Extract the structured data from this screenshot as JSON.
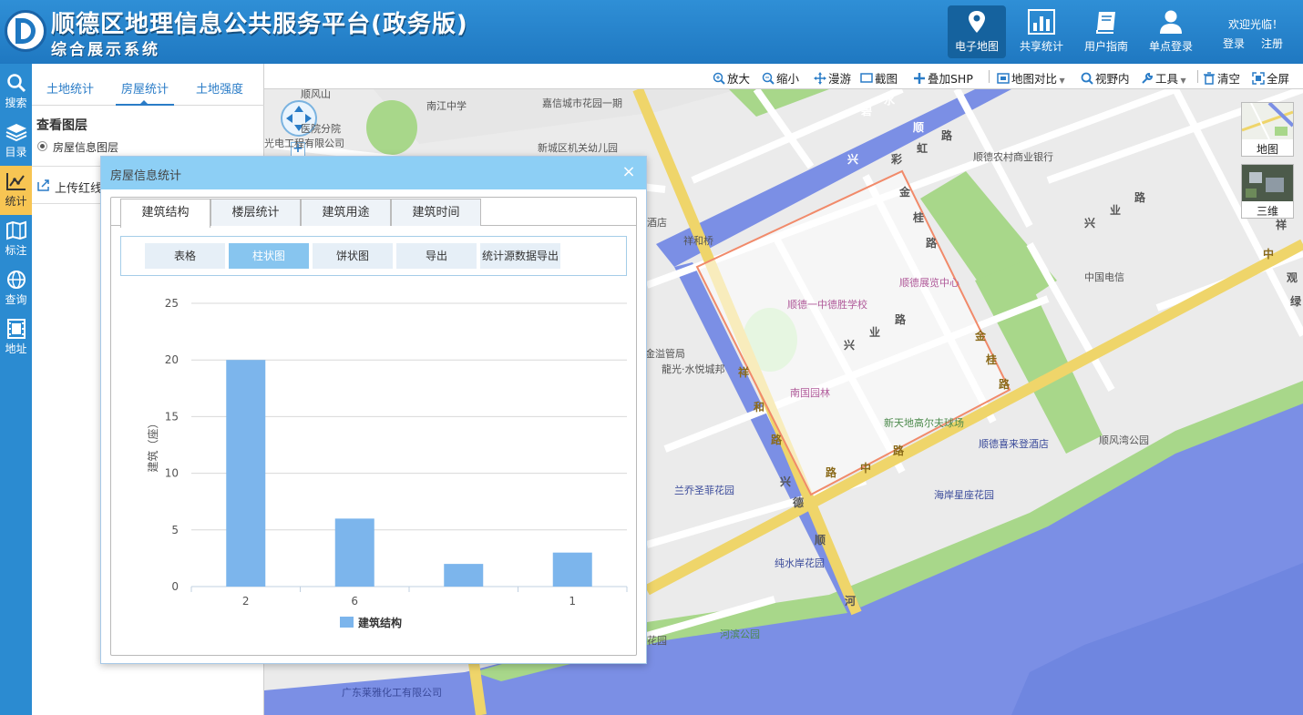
{
  "header": {
    "title": "顺德区地理信息公共服务平台(政务版)",
    "subtitle": "综合展示系统",
    "nav": [
      {
        "label": "电子地图",
        "icon": "map-pin-icon",
        "active": true
      },
      {
        "label": "共享统计",
        "icon": "bar-chart-icon",
        "active": false
      },
      {
        "label": "用户指南",
        "icon": "book-icon",
        "active": false
      },
      {
        "label": "单点登录",
        "icon": "user-icon",
        "active": false
      }
    ],
    "welcome": "欢迎光临！",
    "login": "登录",
    "register": "注册"
  },
  "rail": [
    {
      "label": "搜索",
      "icon": "search-icon"
    },
    {
      "label": "目录",
      "icon": "layers-icon"
    },
    {
      "label": "统计",
      "icon": "chart-icon",
      "active": true
    },
    {
      "label": "标注",
      "icon": "map-mark-icon"
    },
    {
      "label": "查询",
      "icon": "globe-icon"
    },
    {
      "label": "地址",
      "icon": "film-icon"
    }
  ],
  "panel": {
    "tabs": [
      "土地统计",
      "房屋统计",
      "土地强度"
    ],
    "active_tab": "房屋统计",
    "layer_title": "查看图层",
    "layer_option": "房屋信息图层",
    "upload_label": "上传红线"
  },
  "toolbar": [
    {
      "label": "放大",
      "icon": "zoom-in-icon"
    },
    {
      "label": "缩小",
      "icon": "zoom-out-icon"
    },
    {
      "label": "漫游",
      "icon": "pan-icon"
    },
    {
      "label": "截图",
      "icon": "screenshot-icon"
    },
    {
      "label": "叠加SHP",
      "icon": "plus-icon"
    },
    {
      "label": "地图对比",
      "icon": "compare-icon"
    },
    {
      "label": "视野内",
      "icon": "search-icon"
    },
    {
      "label": "工具",
      "icon": "wrench-icon"
    },
    {
      "label": "清空",
      "icon": "trash-icon"
    },
    {
      "label": "全屏",
      "icon": "fullscreen-icon"
    }
  ],
  "basemaps": [
    {
      "label": "地图"
    },
    {
      "label": "三维"
    }
  ],
  "map": {
    "pois": {
      "shunfengshan": "顺风山",
      "nanjiang": "南江中学",
      "jiaxin": "嘉信城市花园一期",
      "hospital": "医院分院",
      "guangdian": "光电工程有限公司",
      "xincheng": "新城区机关幼儿园",
      "bank": "顺德农村商业银行",
      "jiudian": "酒店",
      "xiangheqiao": "祥和桥",
      "zhanlan": "顺德展览中心",
      "zhongde": "顺德一中德胜学校",
      "telecom": "中国电信",
      "jinyuan": "金溢管局",
      "longguang": "龍光·水悦城邦",
      "nanguo": "南国园林",
      "golf": "新天地高尔夫球场",
      "xilaideng": "顺德喜来登酒店",
      "shunfengwan": "顺风湾公园",
      "lanqiao": "兰乔圣菲花园",
      "haian": "海岸星座花园",
      "chunshui": "纯水岸花园",
      "huayuan": "花园",
      "hebin": "河滨公园",
      "laiya": "广东莱雅化工有限公司"
    },
    "roads": {
      "bishui": [
        "碧",
        "水",
        "顺"
      ],
      "xinghong": [
        "彩",
        "虹",
        "路"
      ],
      "jingui": [
        "金",
        "桂",
        "路"
      ],
      "xingye": [
        "兴",
        "业",
        "路"
      ],
      "xingye2": [
        "兴",
        "业",
        "路"
      ],
      "xiangheL": [
        "祥",
        "和",
        "路"
      ],
      "zhonglu": [
        "中",
        "路"
      ],
      "lu": "路",
      "jingui2": [
        "金",
        "桂",
        "路"
      ],
      "xiangshun": [
        "兴",
        "德",
        "顺"
      ],
      "he": "河",
      "xing": "兴",
      "zhong": "中",
      "guan": [
        "观",
        "绿"
      ],
      "xiang": "祥"
    }
  },
  "dialog": {
    "title": "房屋信息统计",
    "close": "×",
    "tabs": [
      "建筑结构",
      "楼层统计",
      "建筑用途",
      "建筑时间"
    ],
    "active_tab": "建筑结构",
    "sub_buttons": [
      "表格",
      "柱状图",
      "饼状图",
      "导出",
      "统计源数据导出"
    ],
    "active_sub": "柱状图"
  },
  "chart_data": {
    "type": "bar",
    "categories": [
      "2",
      "6",
      "",
      "1"
    ],
    "series": [
      {
        "name": "建筑结构",
        "values": [
          20,
          6,
          2,
          3
        ],
        "color": "#7cb5ec"
      }
    ],
    "ylabel": "建筑（座）",
    "ylim": [
      0,
      25
    ],
    "yticks": [
      0,
      5,
      10,
      15,
      20,
      25
    ],
    "grid": true,
    "legend": "bottom"
  },
  "colors": {
    "header": "#2f8fd6",
    "rail": "#2b8bd1",
    "rail_active": "#f7c553",
    "accent": "#2a7cc7",
    "bar": "#7cb5ec",
    "dialog_head": "#8dcff5",
    "river": "#7b8fe5",
    "green": "#a8d78a",
    "main_road": "#efd56a"
  }
}
